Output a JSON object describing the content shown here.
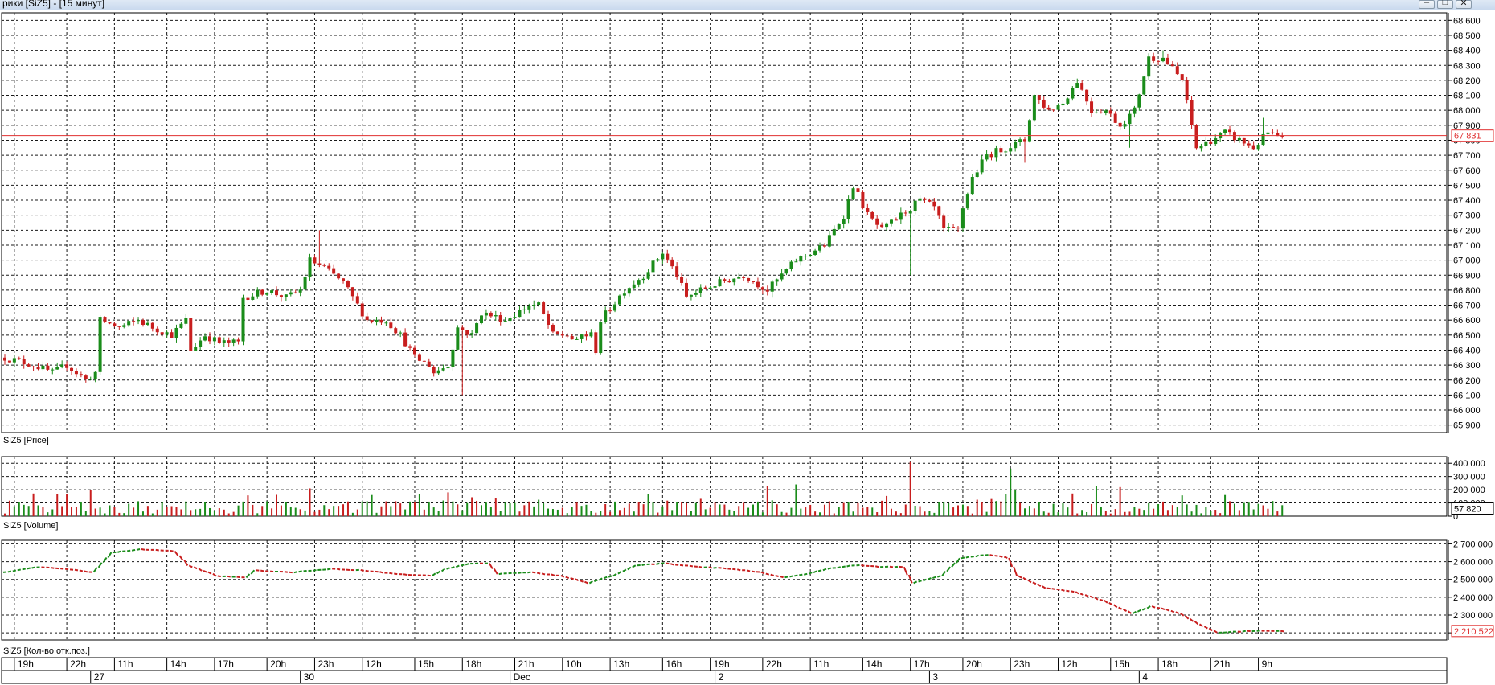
{
  "window": {
    "title": "рики [SiZ5] - [15 минут]",
    "buttons": {
      "minimize": "–",
      "restore": "□",
      "close": "✕"
    }
  },
  "colors": {
    "up": "#1a8c1a",
    "down": "#c81e1e",
    "grid": "#000000",
    "current_line": "#e03030",
    "text": "#000000"
  },
  "chart_data": [
    {
      "type": "candlestick",
      "panel_label": "SiZ5 [Price]",
      "y_ticks": [
        "68 600",
        "68 500",
        "68 400",
        "68 300",
        "68 200",
        "68 100",
        "68 000",
        "67 900",
        "67 800",
        "67 700",
        "67 600",
        "67 500",
        "67 400",
        "67 300",
        "67 200",
        "67 100",
        "67 000",
        "66 900",
        "66 800",
        "66 700",
        "66 600",
        "66 500",
        "66 400",
        "66 300",
        "66 200",
        "66 100",
        "66 000",
        "65 900"
      ],
      "ylim": [
        65850,
        68650
      ],
      "current_value": 67831,
      "current_label": "67 831",
      "close_path": [
        [
          0,
          66350
        ],
        [
          6,
          66300
        ],
        [
          10,
          66250
        ],
        [
          13,
          66300
        ],
        [
          17,
          66200
        ],
        [
          19,
          66250
        ],
        [
          20,
          66600
        ],
        [
          24,
          66550
        ],
        [
          28,
          66600
        ],
        [
          31,
          66550
        ],
        [
          35,
          66500
        ],
        [
          38,
          66600
        ],
        [
          39,
          66400
        ],
        [
          42,
          66500
        ],
        [
          45,
          66450
        ],
        [
          49,
          66450
        ],
        [
          50,
          66750
        ],
        [
          55,
          66800
        ],
        [
          59,
          66750
        ],
        [
          62,
          66800
        ],
        [
          64,
          67000
        ],
        [
          67,
          66950
        ],
        [
          71,
          66850
        ],
        [
          74,
          66700
        ],
        [
          76,
          66600
        ],
        [
          80,
          66600
        ],
        [
          83,
          66500
        ],
        [
          86,
          66350
        ],
        [
          89,
          66300
        ],
        [
          90,
          66250
        ],
        [
          93,
          66300
        ],
        [
          95,
          66550
        ],
        [
          98,
          66500
        ],
        [
          100,
          66650
        ],
        [
          105,
          66600
        ],
        [
          110,
          66700
        ],
        [
          112,
          66700
        ],
        [
          115,
          66500
        ],
        [
          118,
          66500
        ],
        [
          120,
          66450
        ],
        [
          121,
          66500
        ],
        [
          123,
          66500
        ],
        [
          124,
          66400
        ],
        [
          125,
          66600
        ],
        [
          130,
          66800
        ],
        [
          134,
          66900
        ],
        [
          138,
          67050
        ],
        [
          141,
          66900
        ],
        [
          143,
          66750
        ],
        [
          146,
          66800
        ],
        [
          150,
          66850
        ],
        [
          155,
          66900
        ],
        [
          160,
          66800
        ],
        [
          163,
          66900
        ],
        [
          166,
          67000
        ],
        [
          169,
          67050
        ],
        [
          172,
          67100
        ],
        [
          176,
          67300
        ],
        [
          178,
          67500
        ],
        [
          181,
          67300
        ],
        [
          184,
          67200
        ],
        [
          188,
          67300
        ],
        [
          192,
          67400
        ],
        [
          195,
          67350
        ],
        [
          197,
          67200
        ],
        [
          200,
          67200
        ],
        [
          201,
          67350
        ],
        [
          203,
          67550
        ],
        [
          206,
          67700
        ],
        [
          210,
          67750
        ],
        [
          214,
          67800
        ],
        [
          216,
          68100
        ],
        [
          219,
          68000
        ],
        [
          222,
          68050
        ],
        [
          225,
          68200
        ],
        [
          228,
          68000
        ],
        [
          231,
          68000
        ],
        [
          234,
          67900
        ],
        [
          237,
          68000
        ],
        [
          240,
          68350
        ],
        [
          243,
          68350
        ],
        [
          247,
          68200
        ],
        [
          250,
          67750
        ],
        [
          253,
          67800
        ],
        [
          256,
          67850
        ],
        [
          259,
          67800
        ],
        [
          262,
          67750
        ],
        [
          265,
          67850
        ],
        [
          268,
          67800
        ]
      ],
      "wicks_extreme": [
        [
          66,
          67200
        ],
        [
          96,
          66100
        ],
        [
          161,
          66750
        ],
        [
          188,
          67350
        ],
        [
          190,
          66900
        ],
        [
          214,
          67650
        ],
        [
          236,
          67750
        ],
        [
          243,
          68400
        ],
        [
          264,
          67950
        ]
      ]
    },
    {
      "type": "bar",
      "panel_label": "SiZ5 [Volume]",
      "y_ticks": [
        "400 000",
        "300 000",
        "200 000",
        "100 000",
        "0"
      ],
      "ylim": [
        0,
        450000
      ],
      "current_label": "57 820",
      "spikes": [
        [
          190,
          410000
        ],
        [
          211,
          360000
        ],
        [
          212,
          200000
        ],
        [
          18,
          200000
        ],
        [
          64,
          210000
        ],
        [
          160,
          230000
        ],
        [
          166,
          240000
        ],
        [
          229,
          230000
        ],
        [
          234,
          220000
        ],
        [
          93,
          180000
        ],
        [
          87,
          170000
        ],
        [
          77,
          160000
        ]
      ]
    },
    {
      "type": "line",
      "panel_label": "SiZ5 [Кол-во отк.поз.]",
      "y_ticks": [
        "2 700 000",
        "2 600 000",
        "2 500 000",
        "2 400 000",
        "2 300 000",
        "2 200 000"
      ],
      "ylim": [
        2160000,
        2720000
      ],
      "current_label": "2 210 522",
      "path": [
        [
          0,
          2540000
        ],
        [
          6,
          2570000
        ],
        [
          12,
          2560000
        ],
        [
          18,
          2540000
        ],
        [
          22,
          2650000
        ],
        [
          28,
          2670000
        ],
        [
          35,
          2660000
        ],
        [
          38,
          2580000
        ],
        [
          44,
          2520000
        ],
        [
          50,
          2510000
        ],
        [
          52,
          2550000
        ],
        [
          60,
          2540000
        ],
        [
          68,
          2560000
        ],
        [
          75,
          2550000
        ],
        [
          82,
          2530000
        ],
        [
          89,
          2520000
        ],
        [
          92,
          2560000
        ],
        [
          97,
          2590000
        ],
        [
          101,
          2590000
        ],
        [
          103,
          2530000
        ],
        [
          110,
          2540000
        ],
        [
          116,
          2520000
        ],
        [
          122,
          2480000
        ],
        [
          127,
          2520000
        ],
        [
          132,
          2580000
        ],
        [
          138,
          2590000
        ],
        [
          145,
          2570000
        ],
        [
          152,
          2560000
        ],
        [
          158,
          2540000
        ],
        [
          163,
          2510000
        ],
        [
          168,
          2530000
        ],
        [
          172,
          2560000
        ],
        [
          178,
          2580000
        ],
        [
          184,
          2570000
        ],
        [
          188,
          2570000
        ],
        [
          190,
          2480000
        ],
        [
          196,
          2520000
        ],
        [
          200,
          2620000
        ],
        [
          206,
          2640000
        ],
        [
          210,
          2620000
        ],
        [
          212,
          2520000
        ],
        [
          218,
          2450000
        ],
        [
          224,
          2430000
        ],
        [
          230,
          2380000
        ],
        [
          236,
          2310000
        ],
        [
          240,
          2350000
        ],
        [
          246,
          2310000
        ],
        [
          250,
          2250000
        ],
        [
          254,
          2200000
        ],
        [
          260,
          2210000
        ],
        [
          268,
          2210000
        ]
      ]
    }
  ],
  "x_axis": {
    "hour_labels": [
      {
        "label": "19h",
        "slot": 2
      },
      {
        "label": "22h",
        "slot": 13
      },
      {
        "label": "11h",
        "slot": 23
      },
      {
        "label": "14h",
        "slot": 34
      },
      {
        "label": "17h",
        "slot": 44
      },
      {
        "label": "20h",
        "slot": 55
      },
      {
        "label": "23h",
        "slot": 65
      },
      {
        "label": "12h",
        "slot": 75
      },
      {
        "label": "15h",
        "slot": 86
      },
      {
        "label": "18h",
        "slot": 96
      },
      {
        "label": "21h",
        "slot": 107
      },
      {
        "label": "10h",
        "slot": 117
      },
      {
        "label": "13h",
        "slot": 127
      },
      {
        "label": "16h",
        "slot": 138
      },
      {
        "label": "19h",
        "slot": 148
      },
      {
        "label": "22h",
        "slot": 159
      },
      {
        "label": "11h",
        "slot": 169
      },
      {
        "label": "14h",
        "slot": 180
      },
      {
        "label": "17h",
        "slot": 190
      },
      {
        "label": "20h",
        "slot": 201
      },
      {
        "label": "23h",
        "slot": 211
      },
      {
        "label": "12h",
        "slot": 221
      },
      {
        "label": "15h",
        "slot": 232
      },
      {
        "label": "18h",
        "slot": 242
      },
      {
        "label": "21h",
        "slot": 253
      },
      {
        "label": "9h",
        "slot": 263
      }
    ],
    "day_labels": [
      {
        "label": "27",
        "slot": 18
      },
      {
        "label": "30",
        "slot": 62
      },
      {
        "label": "Dec",
        "slot": 106
      },
      {
        "label": "2",
        "slot": 149
      },
      {
        "label": "3",
        "slot": 194
      },
      {
        "label": "4",
        "slot": 238
      }
    ],
    "slot_count": 269
  }
}
